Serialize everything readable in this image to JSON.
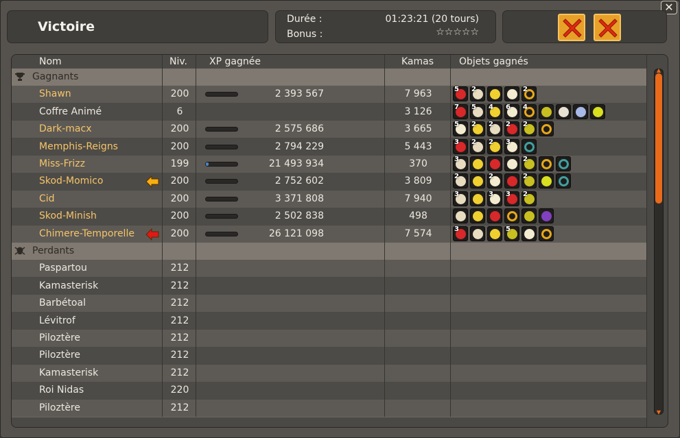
{
  "window": {
    "close_glyph": "✕",
    "title": "Victoire",
    "duration_label": "Durée :",
    "duration_value": "01:23:21 (20 tours)",
    "bonus_label": "Bonus :",
    "bonus_stars": "☆☆☆☆☆"
  },
  "buttons": [
    {
      "name": "close-results-button-1"
    },
    {
      "name": "close-results-button-2"
    }
  ],
  "columns": {
    "name": "Nom",
    "level": "Niv.",
    "xp": "XP gagnée",
    "kamas": "Kamas",
    "items": "Objets gagnés"
  },
  "winners_label": "Gagnants",
  "losers_label": "Perdants",
  "winners": [
    {
      "name": "Shawn",
      "level": "200",
      "xp": "2 393 567",
      "kamas": "7 963",
      "xp_progress": 0.0,
      "color": "gold",
      "arrow": "",
      "items": [
        {
          "c": "5",
          "t": "red"
        },
        {
          "c": "2",
          "t": "bone"
        },
        {
          "c": "",
          "t": "banana"
        },
        {
          "c": "",
          "t": "leaf"
        },
        {
          "c": "2",
          "t": "ring"
        }
      ]
    },
    {
      "name": "Coffre Animé",
      "level": "6",
      "xp": "",
      "kamas": "3 126",
      "xp_progress": -1,
      "color": "white",
      "arrow": "",
      "items": [
        {
          "c": "7",
          "t": "red"
        },
        {
          "c": "5",
          "t": "bone"
        },
        {
          "c": "4",
          "t": "banana"
        },
        {
          "c": "6",
          "t": "leaf"
        },
        {
          "c": "4",
          "t": "ring"
        },
        {
          "c": "",
          "t": "green"
        },
        {
          "c": "",
          "t": "stick"
        },
        {
          "c": "",
          "t": "orb"
        },
        {
          "c": "",
          "t": "gem"
        }
      ]
    },
    {
      "name": "Dark-macx",
      "level": "200",
      "xp": "2 575 686",
      "kamas": "3 665",
      "xp_progress": 0.0,
      "color": "gold",
      "arrow": "",
      "items": [
        {
          "c": "5",
          "t": "leaf"
        },
        {
          "c": "2",
          "t": "banana"
        },
        {
          "c": "2",
          "t": "bone"
        },
        {
          "c": "2",
          "t": "red"
        },
        {
          "c": "2",
          "t": "green"
        },
        {
          "c": "",
          "t": "ring"
        }
      ]
    },
    {
      "name": "Memphis-Reigns",
      "level": "200",
      "xp": "2 794 229",
      "kamas": "5 443",
      "xp_progress": 0.0,
      "color": "gold",
      "arrow": "",
      "items": [
        {
          "c": "3",
          "t": "red"
        },
        {
          "c": "2",
          "t": "bone"
        },
        {
          "c": "2",
          "t": "banana"
        },
        {
          "c": "3",
          "t": "leaf"
        },
        {
          "c": "",
          "t": "omega"
        }
      ]
    },
    {
      "name": "Miss-Frizz",
      "level": "199",
      "xp": "21 493 934",
      "kamas": "370",
      "xp_progress": 0.08,
      "color": "gold",
      "arrow": "",
      "items": [
        {
          "c": "3",
          "t": "bone"
        },
        {
          "c": "",
          "t": "banana"
        },
        {
          "c": "",
          "t": "red"
        },
        {
          "c": "",
          "t": "leaf"
        },
        {
          "c": "2",
          "t": "green"
        },
        {
          "c": "",
          "t": "ring"
        },
        {
          "c": "",
          "t": "omega"
        }
      ]
    },
    {
      "name": "Skod-Momico",
      "level": "200",
      "xp": "2 752 602",
      "kamas": "3 809",
      "xp_progress": 0.0,
      "color": "gold",
      "arrow": "yellow",
      "items": [
        {
          "c": "2",
          "t": "bone"
        },
        {
          "c": "",
          "t": "banana"
        },
        {
          "c": "2",
          "t": "leaf"
        },
        {
          "c": "",
          "t": "red"
        },
        {
          "c": "2",
          "t": "green"
        },
        {
          "c": "",
          "t": "gem"
        },
        {
          "c": "",
          "t": "omega"
        }
      ]
    },
    {
      "name": "Cid",
      "level": "200",
      "xp": "3 371 808",
      "kamas": "7 940",
      "xp_progress": 0.0,
      "color": "gold",
      "arrow": "",
      "items": [
        {
          "c": "3",
          "t": "bone"
        },
        {
          "c": "",
          "t": "banana"
        },
        {
          "c": "3",
          "t": "leaf"
        },
        {
          "c": "3",
          "t": "red"
        },
        {
          "c": "2",
          "t": "green"
        }
      ]
    },
    {
      "name": "Skod-Minish",
      "level": "200",
      "xp": "2 502 838",
      "kamas": "498",
      "xp_progress": 0.0,
      "color": "gold",
      "arrow": "",
      "items": [
        {
          "c": "",
          "t": "bone"
        },
        {
          "c": "",
          "t": "banana"
        },
        {
          "c": "",
          "t": "red"
        },
        {
          "c": "",
          "t": "ring"
        },
        {
          "c": "",
          "t": "green"
        },
        {
          "c": "",
          "t": "wand"
        }
      ]
    },
    {
      "name": "Chimere-Temporelle",
      "level": "200",
      "xp": "26 121 098",
      "kamas": "7 574",
      "xp_progress": 0.0,
      "color": "gold",
      "arrow": "red",
      "items": [
        {
          "c": "3",
          "t": "red"
        },
        {
          "c": "",
          "t": "bone"
        },
        {
          "c": "",
          "t": "banana"
        },
        {
          "c": "5",
          "t": "green"
        },
        {
          "c": "",
          "t": "leaf"
        },
        {
          "c": "",
          "t": "ring"
        }
      ]
    }
  ],
  "losers": [
    {
      "name": "Paspartou",
      "level": "212"
    },
    {
      "name": "Kamasterisk",
      "level": "212"
    },
    {
      "name": "Barbétoal",
      "level": "212"
    },
    {
      "name": "Lévitrof",
      "level": "212"
    },
    {
      "name": "Piloztère",
      "level": "212"
    },
    {
      "name": "Piloztère",
      "level": "212"
    },
    {
      "name": "Kamasterisk",
      "level": "212"
    },
    {
      "name": "Roi Nidas",
      "level": "220"
    },
    {
      "name": "Piloztère",
      "level": "212"
    }
  ],
  "colors": {
    "accent_orange": "#e86a1a",
    "winner_name": "#f5c46a",
    "xp_bar": "#4a86c8"
  }
}
